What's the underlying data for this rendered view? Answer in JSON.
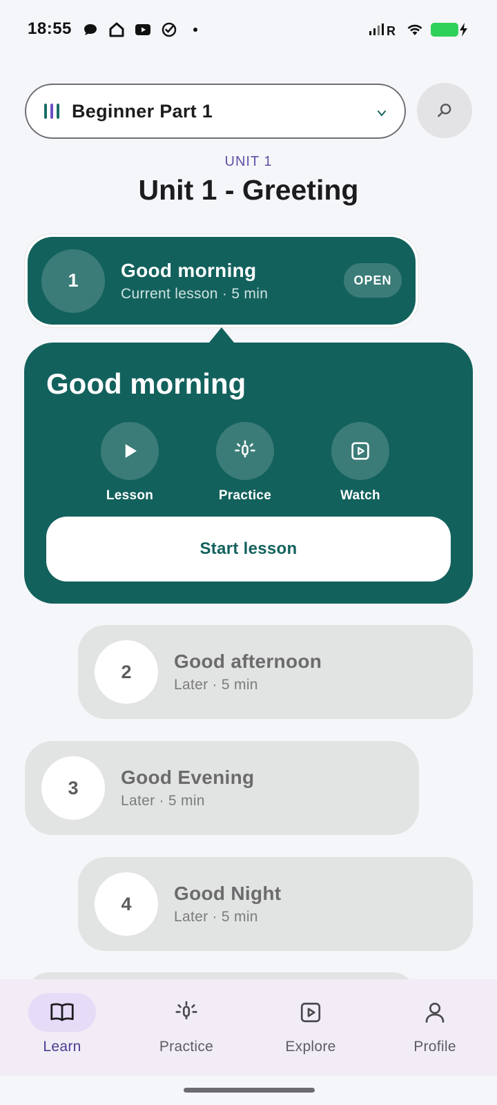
{
  "status_bar": {
    "time": "18:55",
    "left_icons": [
      "chat-bubble-icon",
      "home-icon",
      "youtube-icon",
      "check-circle-icon",
      "dot"
    ],
    "signal_text": "R",
    "battery_color": "#2fd159"
  },
  "course_selector": {
    "label": "Beginner Part 1",
    "chevron": "v"
  },
  "unit": {
    "kicker": "UNIT 1",
    "title": "Unit 1 - Greeting"
  },
  "lessons": [
    {
      "number": "1",
      "title": "Good morning",
      "subtitle": "Current lesson · 5 min",
      "status": "current",
      "badge": "OPEN"
    },
    {
      "number": "2",
      "title": "Good afternoon",
      "subtitle": "Later · 5 min",
      "status": "later"
    },
    {
      "number": "3",
      "title": "Good Evening",
      "subtitle": "Later · 5 min",
      "status": "later"
    },
    {
      "number": "4",
      "title": "Good Night",
      "subtitle": "Later · 5 min",
      "status": "later"
    }
  ],
  "panel": {
    "title": "Good morning",
    "actions": [
      {
        "label": "Lesson",
        "icon": "play-icon"
      },
      {
        "label": "Practice",
        "icon": "mic-sparkle-icon"
      },
      {
        "label": "Watch",
        "icon": "video-play-icon"
      }
    ],
    "start_label": "Start lesson"
  },
  "bottom_nav": [
    {
      "label": "Learn",
      "icon": "book-icon",
      "active": true
    },
    {
      "label": "Practice",
      "icon": "mic-sparkle-icon",
      "active": false
    },
    {
      "label": "Explore",
      "icon": "video-play-icon",
      "active": false
    },
    {
      "label": "Profile",
      "icon": "person-icon",
      "active": false
    }
  ],
  "colors": {
    "accent_teal": "#13615d",
    "accent_purple": "#5f4fa6",
    "nav_background": "#f1ecf6"
  }
}
